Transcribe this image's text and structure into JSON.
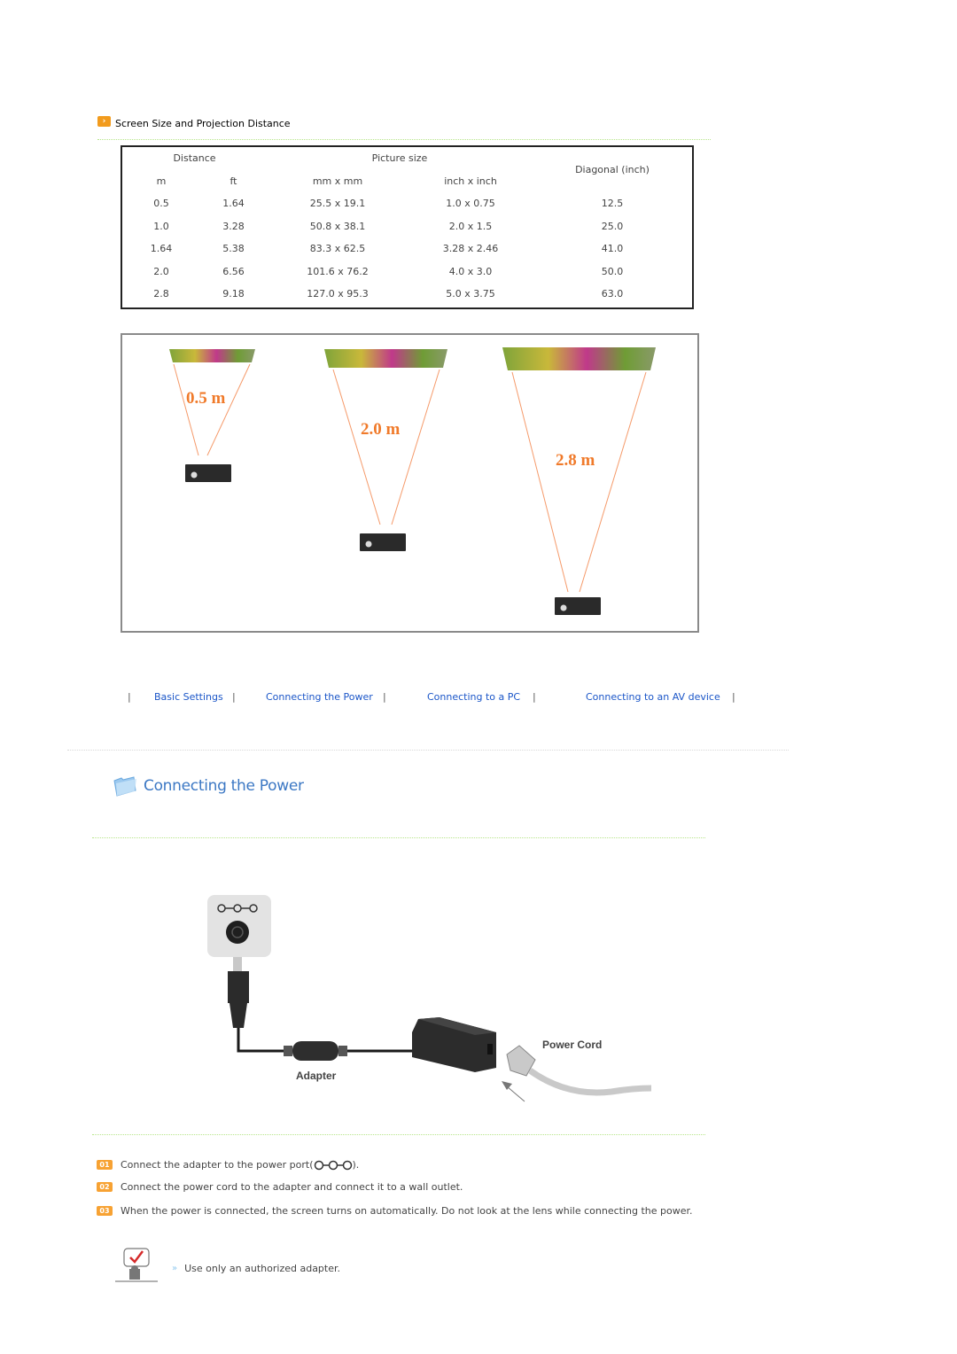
{
  "section1": {
    "title": "Screen Size and Projection Distance",
    "table": {
      "group_headers": {
        "distance": "Distance",
        "picture_size": "Picture size",
        "diagonal": "Diagonal (inch)"
      },
      "sub_headers": [
        "m",
        "ft",
        "mm x mm",
        "inch x inch"
      ],
      "rows": [
        [
          "0.5",
          "1.64",
          "25.5 x 19.1",
          "1.0 x 0.75",
          "12.5"
        ],
        [
          "1.0",
          "3.28",
          "50.8 x 38.1",
          "2.0 x 1.5",
          "25.0"
        ],
        [
          "1.64",
          "5.38",
          "83.3 x 62.5",
          "3.28 x 2.46",
          "41.0"
        ],
        [
          "2.0",
          "6.56",
          "101.6 x 76.2",
          "4.0 x 3.0",
          "50.0"
        ],
        [
          "2.8",
          "9.18",
          "127.0 x 95.3",
          "5.0 x 3.75",
          "63.0"
        ]
      ]
    },
    "diagram_labels": [
      "0.5 m",
      "2.0 m",
      "2.8 m"
    ]
  },
  "nav": {
    "links": [
      "Basic Settings",
      "Connecting the Power",
      "Connecting to a PC",
      "Connecting to an AV device"
    ],
    "separator": "|"
  },
  "section2": {
    "title": "Connecting the Power",
    "illustration_labels": {
      "adapter": "Adapter",
      "power_cord": "Power Cord"
    },
    "steps": [
      {
        "badge": "01",
        "text": "Connect the adapter to the power port(",
        "suffix": ")."
      },
      {
        "badge": "02",
        "text": "Connect the power cord to the adapter and connect it to a wall outlet."
      },
      {
        "badge": "03",
        "text": "When the power is connected, the screen turns on automatically. Do not look at the lens while connecting the power."
      }
    ],
    "note": "Use only an authorized adapter."
  },
  "colors": {
    "accent_orange": "#f29b1d",
    "link_blue": "#1b56c8",
    "heading_blue": "#3c78c4",
    "divider_green": "#b7e58a",
    "diagram_orange": "#f07a2a"
  }
}
